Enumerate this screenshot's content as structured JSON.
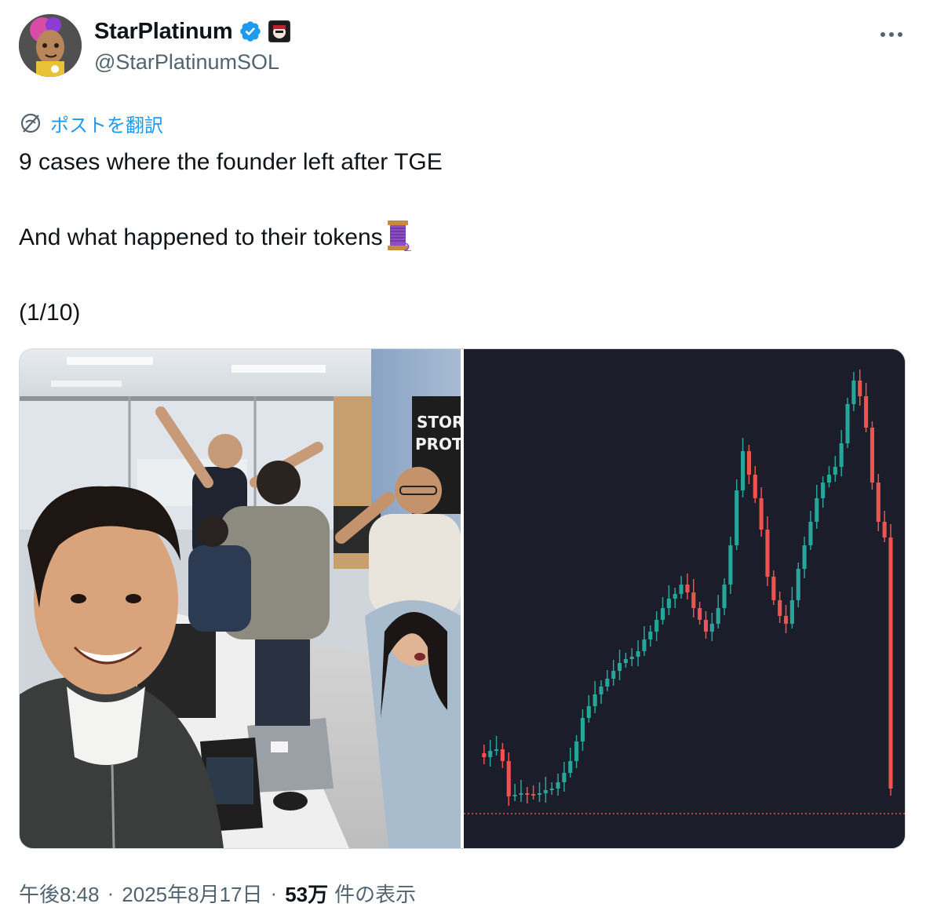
{
  "author": {
    "display_name": "StarPlatinum",
    "handle": "@StarPlatinumSOL",
    "verified": true,
    "avatar_icon": "avatar-illustration",
    "affiliation_icon": "affiliate-badge-icon"
  },
  "post": {
    "translate_label": "ポストを翻訳",
    "text_lines": [
      "9 cases where the founder left after TGE",
      "And what happened to their tokens",
      "(1/10)"
    ],
    "thread_emoji": "thread-spool-icon",
    "sign_text": [
      "STOR",
      "PROTO"
    ]
  },
  "meta": {
    "time": "午後8:48",
    "separator": "·",
    "date": "2025年8月17日",
    "views_count": "53万",
    "views_label": "件の表示"
  },
  "colors": {
    "link": "#1d9bf0",
    "secondary": "#536471",
    "primary_text": "#0f1419",
    "candle_up": "#26a69a",
    "candle_down": "#ef5350",
    "chart_bg": "#1b1d2a"
  }
}
